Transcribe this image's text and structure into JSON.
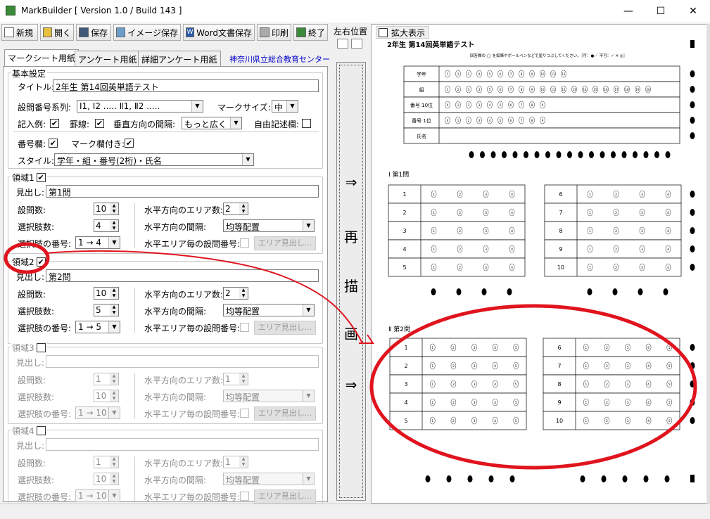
{
  "window": {
    "title": "MarkBuilder [ Version 1.0 / Build 143 ]"
  },
  "toolbar": {
    "new": "新規",
    "open": "開く",
    "save": "保存",
    "image_save": "イメージ保存",
    "word_save": "Word文書保存",
    "print": "印刷",
    "exit": "終了"
  },
  "tabs": [
    "マークシート用紙",
    "アンケート用紙",
    "詳細アンケート用紙"
  ],
  "org_link": "神奈川県立総合教育センター",
  "basic": {
    "group_title": "基本設定",
    "title_label": "タイトル:",
    "title_value": "2年生  第14回英単語テスト",
    "series_label": "設問番号系列:",
    "series_value": "Ⅰ1, Ⅰ2 ..... Ⅱ1, Ⅱ2 .....",
    "mark_size_label": "マークサイズ:",
    "mark_size_value": "中",
    "example_label": "記入例:",
    "ruled_label": "罫線:",
    "vspacing_label": "垂直方向の間隔:",
    "vspacing_value": "もっと広く",
    "freeform_label": "自由記述欄:",
    "number_label": "番号欄:",
    "mark_col_label": "マーク欄付き:",
    "style_label": "スタイル:",
    "style_value": "学年・組・番号(2桁)・氏名"
  },
  "labels": {
    "heading": "見出し:",
    "questions": "設問数:",
    "choices": "選択肢数:",
    "choice_nums": "選択肢の番号:",
    "h_areas": "水平方向のエリア数:",
    "h_spacing": "水平方向の間隔:",
    "h_qnum": "水平エリア毎の設問番号:",
    "area_heading_btn": "エリア見出し..."
  },
  "regions": [
    {
      "name": "領域1",
      "checked": "✔",
      "heading": "第1問",
      "questions": "10",
      "choices": "4",
      "choice_nums": "1 → 4",
      "h_areas": "2",
      "h_spacing": "均等配置"
    },
    {
      "name": "領域2",
      "checked": "✔",
      "heading": "第2問",
      "questions": "10",
      "choices": "5",
      "choice_nums": "1 → 5",
      "h_areas": "2",
      "h_spacing": "均等配置"
    },
    {
      "name": "領域3",
      "checked": "",
      "heading": "",
      "questions": "1",
      "choices": "10",
      "choice_nums": "1 → 10",
      "h_areas": "1",
      "h_spacing": "均等配置"
    },
    {
      "name": "領域4",
      "checked": "",
      "heading": "",
      "questions": "1",
      "choices": "10",
      "choice_nums": "1 → 10",
      "h_areas": "1",
      "h_spacing": "均等配置"
    }
  ],
  "middle": {
    "lr_label": "左右位置",
    "arrow": "⇒",
    "redraw_chars": [
      "再",
      "描",
      "画"
    ]
  },
  "preview": {
    "zoom_label": "拡大表示",
    "sheet_title": "2年生  第14回英単語テスト",
    "instruction": "回答欄の ◯ を鉛筆やボールペンなどで塗りつぶしてください。［可：●／ 不可：✓ ✕ ◎］",
    "info_rows": [
      {
        "label": "学年",
        "marks": [
          "1",
          "2",
          "3",
          "4",
          "5",
          "6",
          "7",
          "8",
          "9",
          "10",
          "11",
          "12"
        ]
      },
      {
        "label": "組",
        "marks": [
          "1",
          "2",
          "3",
          "4",
          "5",
          "6",
          "7",
          "8",
          "9",
          "10",
          "11",
          "12",
          "13",
          "14",
          "15",
          "16",
          "17",
          "18",
          "19",
          "20"
        ]
      },
      {
        "label": "番号 10位",
        "marks": [
          "0",
          "1",
          "2",
          "3",
          "4",
          "5",
          "6",
          "7",
          "8",
          "9"
        ]
      },
      {
        "label": "番号 1位",
        "marks": [
          "0",
          "1",
          "2",
          "3",
          "4",
          "5",
          "6",
          "7",
          "8",
          "9"
        ]
      },
      {
        "label": "氏名",
        "marks": []
      }
    ],
    "section1_title": "Ⅰ  第1問",
    "section2_title": "Ⅱ  第2問"
  },
  "colors": {
    "annotation_red": "#e0141e",
    "link_blue": "#0000c8"
  }
}
